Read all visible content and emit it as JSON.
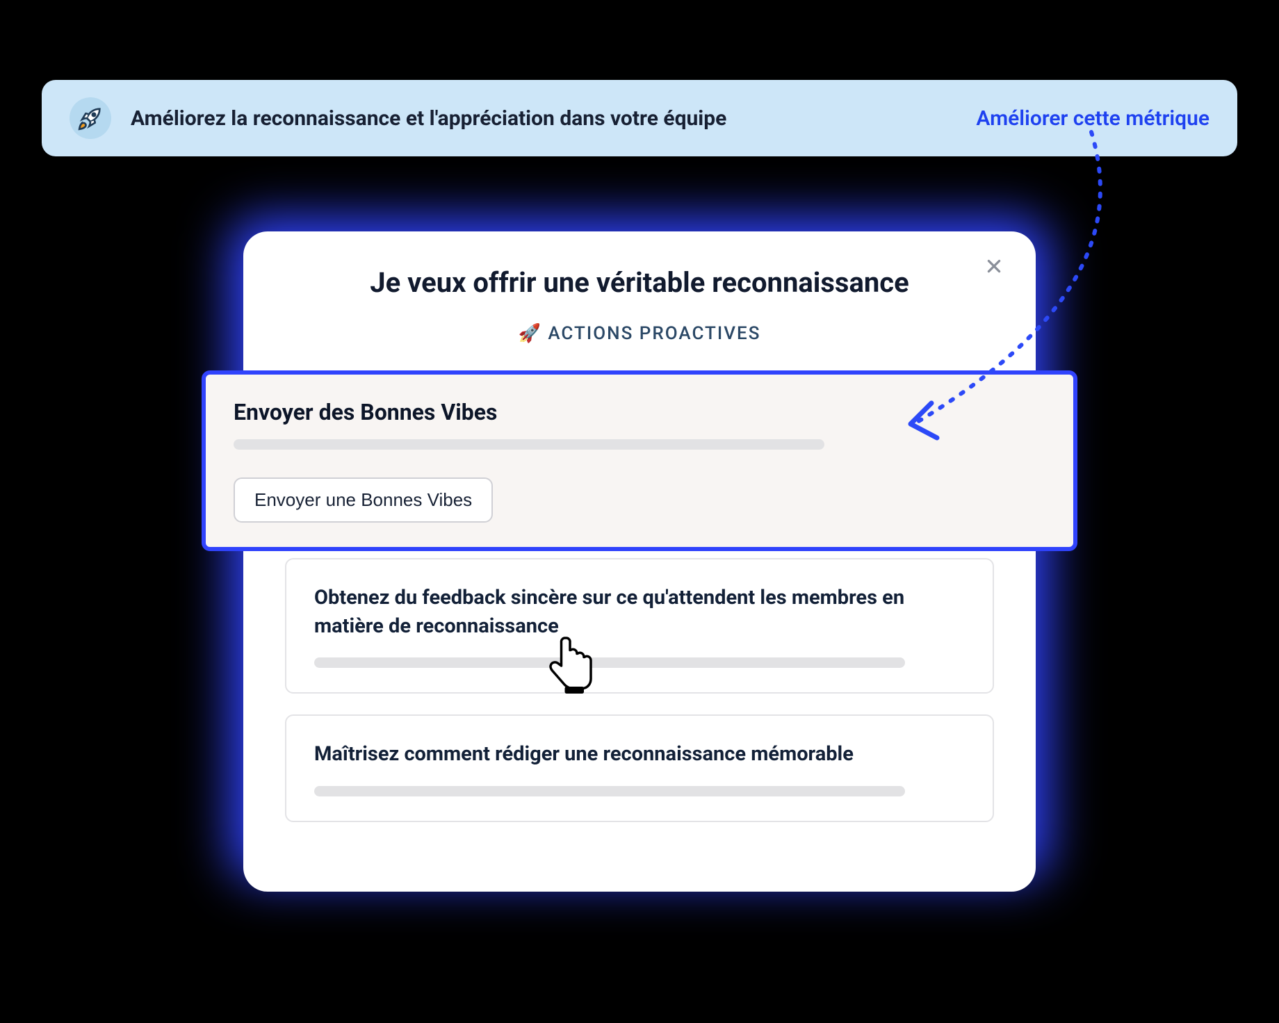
{
  "banner": {
    "title": "Améliorez la reconnaissance et l'appréciation dans votre équipe",
    "link": "Améliorer cette métrique",
    "icon": "rocket-icon"
  },
  "modal": {
    "title": "Je veux offrir une véritable reconnaissance",
    "subtitle_prefix": "🚀",
    "subtitle": "ACTIONS PROACTIVES",
    "close_icon": "close-icon"
  },
  "highlighted_action": {
    "title": "Envoyer des Bonnes Vibes",
    "button": "Envoyer une Bonnes Vibes"
  },
  "actions": [
    {
      "title": "Obtenez du feedback sincère sur ce qu'attendent les membres en matière de reconnaissance"
    },
    {
      "title": "Maîtrisez comment rédiger une reconnaissance mémorable"
    }
  ],
  "colors": {
    "banner_bg": "#CDE6F8",
    "accent": "#3043FC",
    "link": "#1E41F0",
    "card_border": "#E3E3E6",
    "highlight_bg": "#F8F5F3"
  }
}
